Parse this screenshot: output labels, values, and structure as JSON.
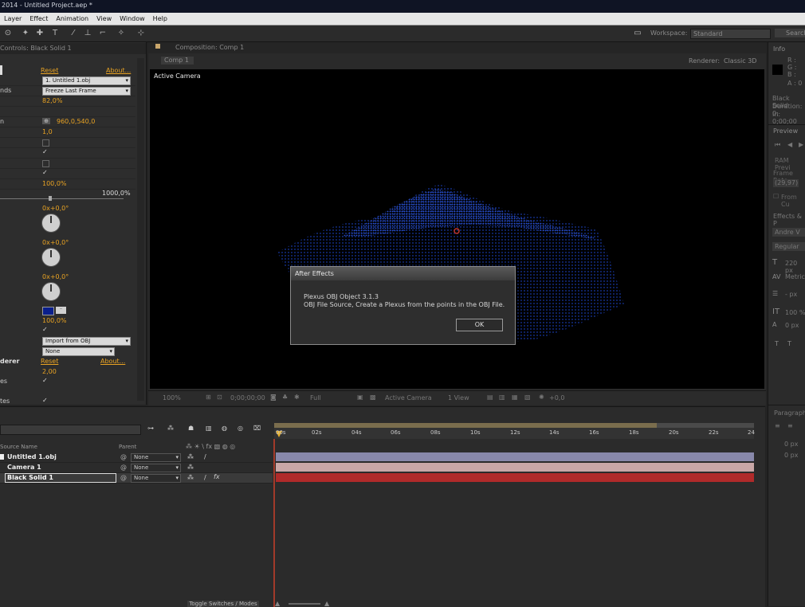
{
  "title_bar": "2014 - Untitled Project.aep *",
  "menu": [
    "Layer",
    "Effect",
    "Animation",
    "View",
    "Window",
    "Help"
  ],
  "workspace": {
    "label": "Workspace:",
    "value": "Standard"
  },
  "search_label": "Search",
  "effect_controls": {
    "tab": "Controls: Black Solid 1",
    "reset": "Reset",
    "about": "About...",
    "rows": [
      {
        "label": "",
        "value": "1. Untitled 1.obj",
        "kind": "dropdown"
      },
      {
        "label": "nds",
        "value": "Freeze Last Frame",
        "kind": "dropdown"
      },
      {
        "label": "",
        "value": "82,0%",
        "kind": "value"
      },
      {
        "label": "",
        "value": "",
        "kind": "blank"
      },
      {
        "label": "n",
        "value": "960,0,540,0",
        "kind": "point"
      },
      {
        "label": "",
        "value": "1,0",
        "kind": "value"
      },
      {
        "label": "",
        "value": "",
        "kind": "checkbox-off"
      },
      {
        "label": "",
        "value": "✓",
        "kind": "checkbox-on"
      },
      {
        "label": "",
        "value": "",
        "kind": "checkbox-off"
      },
      {
        "label": "",
        "value": "✓",
        "kind": "checkbox-on"
      },
      {
        "label": "",
        "value": "100,0%",
        "kind": "value"
      }
    ],
    "slider_max": "1000,0%",
    "rot1": "0x+0,0°",
    "rot2": "0x+0,0°",
    "rot3": "0x+0,0°",
    "opacity2": "100,0%",
    "import_dd": "Import from OBJ",
    "none_dd": "None",
    "renderer_label": "derer",
    "renderer_value": "2,00",
    "es_label": "es",
    "tes_label": "tes"
  },
  "composition": {
    "tab": "Composition: Comp 1",
    "subtab": "Comp 1",
    "renderer": "Renderer:",
    "renderer_val": "Classic 3D",
    "active_camera": "Active Camera",
    "bottom": {
      "zoom": "100%",
      "time": "0;00;00;00",
      "res": "Full",
      "camera": "Active Camera",
      "views": "1 View",
      "offset": "+0,0"
    }
  },
  "dialog": {
    "title": "After Effects",
    "line1": "Plexus OBJ Object 3.1.3",
    "line2": "OBJ File Source, Create a Plexus from the points in the OBJ File.",
    "ok": "OK"
  },
  "right_panel": {
    "info": "Info",
    "r": "R :",
    "g": "G :",
    "b": "B :",
    "a": "A : 0",
    "layer": "Black Solid",
    "duration": "Duration: 0;",
    "in": "In: 0;00;00",
    "preview": "Preview",
    "ram": "RAM Previ",
    "framerate": "Frame Rate",
    "fr_value": "(29,97)",
    "from": "From Cu",
    "effects": "Effects & P",
    "font": "Andre V",
    "style": "Regular",
    "size": "220 px",
    "metrics": "Metrics",
    "px": "- px",
    "pct": "100 %",
    "px0": "0 px",
    "paragraph": "Paragraph",
    "p1": "0 px",
    "p2": "0 px"
  },
  "timeline": {
    "col_source": "Source Name",
    "col_parent": "Parent",
    "layers": [
      {
        "name": "Untitled 1.obj",
        "parent": "None"
      },
      {
        "name": "Camera 1",
        "parent": "None"
      },
      {
        "name": "Black Solid 1",
        "parent": "None"
      }
    ],
    "ticks": [
      "00s",
      "02s",
      "04s",
      "06s",
      "08s",
      "10s",
      "12s",
      "14s",
      "16s",
      "18s",
      "20s",
      "22s",
      "24"
    ],
    "toggle": "Toggle Switches / Modes"
  },
  "colors": {
    "accent": "#e9a323",
    "swatch": "#0a1f8c",
    "plexus": "#1a3fb8"
  }
}
